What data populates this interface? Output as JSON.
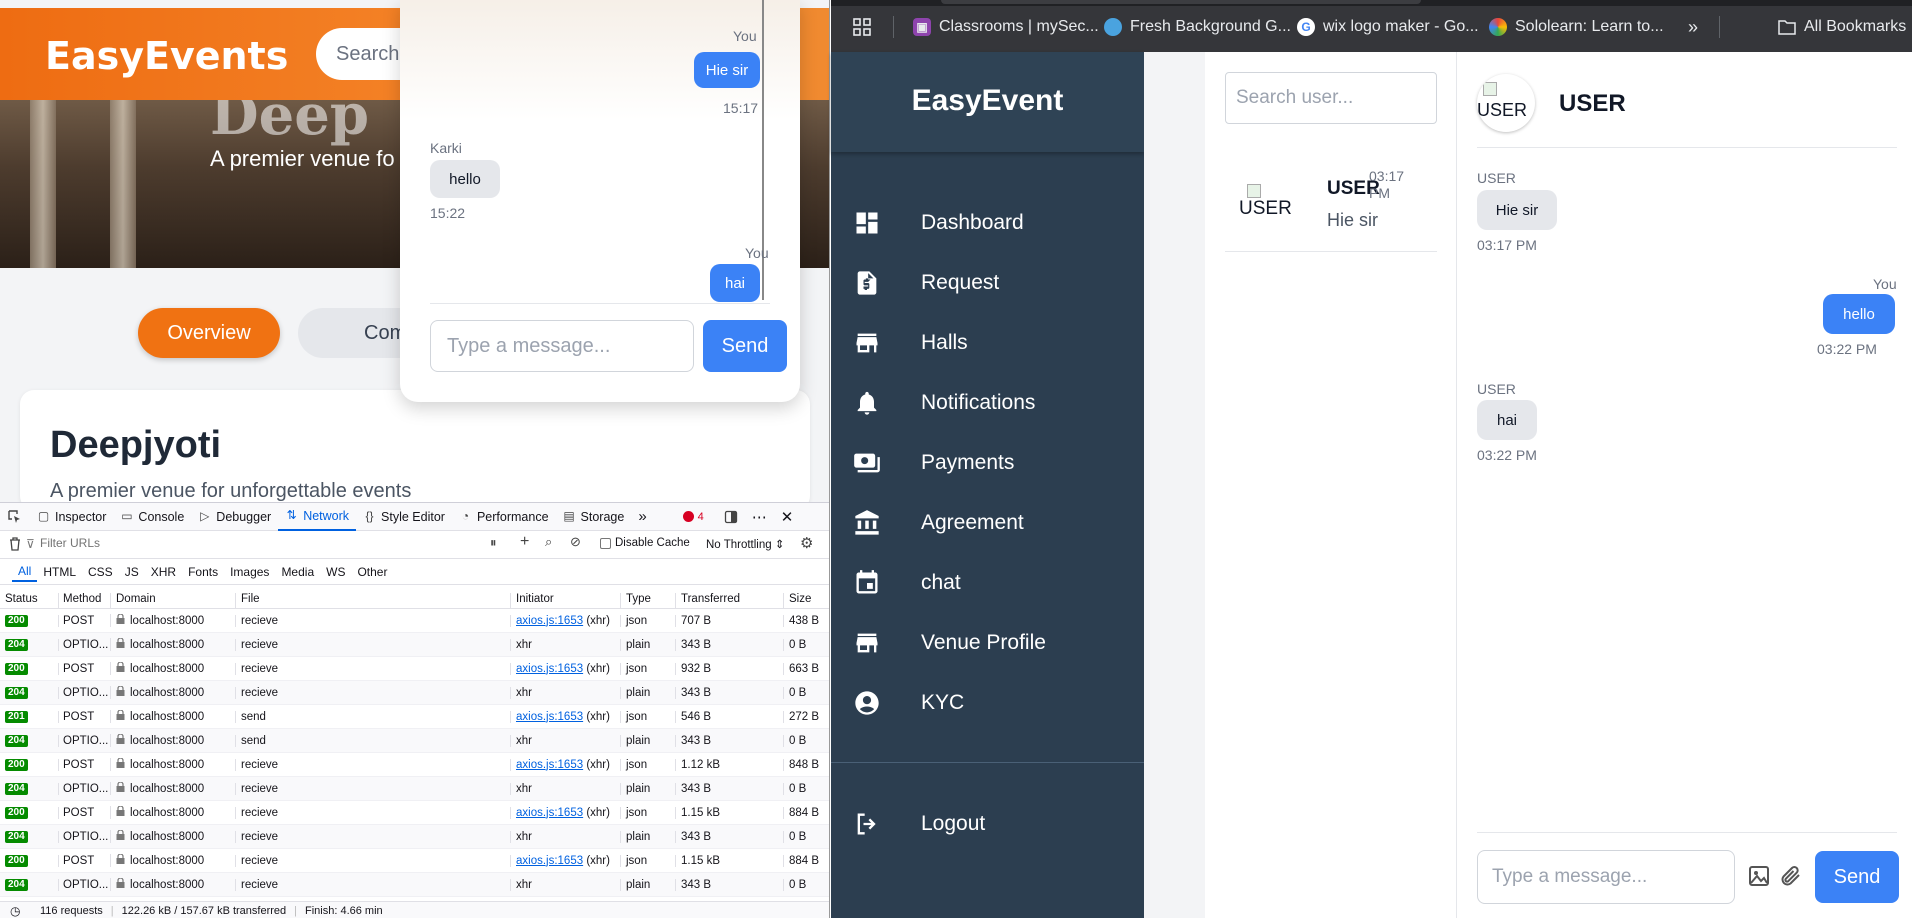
{
  "left_app": {
    "logo": "EasyEvents",
    "search_placeholder": "Search",
    "hero_title": "Deep",
    "hero_subtitle": "A premier venue fo",
    "tabs": {
      "overview": "Overview",
      "complete": "Comple"
    },
    "venue_name": "Deepjyoti",
    "venue_tagline": "A premier venue for unforgettable events"
  },
  "popup_chat": {
    "messages": [
      {
        "sender": "You",
        "text": "Hie sir",
        "time": "15:17"
      },
      {
        "sender": "Karki",
        "text": "hello",
        "time": "15:22"
      },
      {
        "sender": "You",
        "text": "hai"
      }
    ],
    "input_placeholder": "Type a message...",
    "send_label": "Send"
  },
  "devtools": {
    "tabs": [
      "Inspector",
      "Console",
      "Debugger",
      "Network",
      "Style Editor",
      "Performance",
      "Storage"
    ],
    "active_tab": "Network",
    "error_count": "4",
    "filter_placeholder": "Filter URLs",
    "disable_cache": "Disable Cache",
    "throttling": "No Throttling",
    "type_filters": [
      "All",
      "HTML",
      "CSS",
      "JS",
      "XHR",
      "Fonts",
      "Images",
      "Media",
      "WS",
      "Other"
    ],
    "columns": [
      "Status",
      "Method",
      "Domain",
      "File",
      "Initiator",
      "Type",
      "Transferred",
      "Size"
    ],
    "rows": [
      {
        "status": "200",
        "method": "POST",
        "domain": "localhost:8000",
        "file": "recieve",
        "initiator_link": "axios.js:1653",
        "initiator_suffix": " (xhr)",
        "type": "json",
        "transferred": "707 B",
        "size": "438 B"
      },
      {
        "status": "204",
        "method": "OPTIO...",
        "domain": "localhost:8000",
        "file": "recieve",
        "initiator_link": "",
        "initiator_suffix": "xhr",
        "type": "plain",
        "transferred": "343 B",
        "size": "0 B"
      },
      {
        "status": "200",
        "method": "POST",
        "domain": "localhost:8000",
        "file": "recieve",
        "initiator_link": "axios.js:1653",
        "initiator_suffix": " (xhr)",
        "type": "json",
        "transferred": "932 B",
        "size": "663 B"
      },
      {
        "status": "204",
        "method": "OPTIO...",
        "domain": "localhost:8000",
        "file": "recieve",
        "initiator_link": "",
        "initiator_suffix": "xhr",
        "type": "plain",
        "transferred": "343 B",
        "size": "0 B"
      },
      {
        "status": "201",
        "method": "POST",
        "domain": "localhost:8000",
        "file": "send",
        "initiator_link": "axios.js:1653",
        "initiator_suffix": " (xhr)",
        "type": "json",
        "transferred": "546 B",
        "size": "272 B"
      },
      {
        "status": "204",
        "method": "OPTIO...",
        "domain": "localhost:8000",
        "file": "send",
        "initiator_link": "",
        "initiator_suffix": "xhr",
        "type": "plain",
        "transferred": "343 B",
        "size": "0 B"
      },
      {
        "status": "200",
        "method": "POST",
        "domain": "localhost:8000",
        "file": "recieve",
        "initiator_link": "axios.js:1653",
        "initiator_suffix": " (xhr)",
        "type": "json",
        "transferred": "1.12 kB",
        "size": "848 B"
      },
      {
        "status": "204",
        "method": "OPTIO...",
        "domain": "localhost:8000",
        "file": "recieve",
        "initiator_link": "",
        "initiator_suffix": "xhr",
        "type": "plain",
        "transferred": "343 B",
        "size": "0 B"
      },
      {
        "status": "200",
        "method": "POST",
        "domain": "localhost:8000",
        "file": "recieve",
        "initiator_link": "axios.js:1653",
        "initiator_suffix": " (xhr)",
        "type": "json",
        "transferred": "1.15 kB",
        "size": "884 B"
      },
      {
        "status": "204",
        "method": "OPTIO...",
        "domain": "localhost:8000",
        "file": "recieve",
        "initiator_link": "",
        "initiator_suffix": "xhr",
        "type": "plain",
        "transferred": "343 B",
        "size": "0 B"
      },
      {
        "status": "200",
        "method": "POST",
        "domain": "localhost:8000",
        "file": "recieve",
        "initiator_link": "axios.js:1653",
        "initiator_suffix": " (xhr)",
        "type": "json",
        "transferred": "1.15 kB",
        "size": "884 B"
      },
      {
        "status": "204",
        "method": "OPTIO...",
        "domain": "localhost:8000",
        "file": "recieve",
        "initiator_link": "",
        "initiator_suffix": "xhr",
        "type": "plain",
        "transferred": "343 B",
        "size": "0 B"
      }
    ],
    "footer": {
      "requests": "116 requests",
      "transferred": "122.26 kB / 157.67 kB transferred",
      "finish": "Finish: 4.66 min"
    }
  },
  "bookmarks": {
    "items": [
      {
        "label": "Classrooms | mySec...",
        "icon": "classroom-icon",
        "color": "#8e44ad"
      },
      {
        "label": "Fresh Background G...",
        "icon": "fresh-bg-icon",
        "color": "#4aa3df"
      },
      {
        "label": "wix logo maker - Go...",
        "icon": "google-icon",
        "color": "#ffffff"
      },
      {
        "label": "Sololearn: Learn to...",
        "icon": "sololearn-icon",
        "color": "#e8453c"
      }
    ],
    "all_bookmarks": "All Bookmarks"
  },
  "sidebar": {
    "logo": "EasyEvent",
    "items": [
      {
        "label": "Dashboard",
        "icon": "dashboard-icon"
      },
      {
        "label": "Request",
        "icon": "request-icon"
      },
      {
        "label": "Halls",
        "icon": "halls-icon"
      },
      {
        "label": "Notifications",
        "icon": "bell-icon"
      },
      {
        "label": "Payments",
        "icon": "payments-icon"
      },
      {
        "label": "Agreement",
        "icon": "bank-icon"
      },
      {
        "label": "chat",
        "icon": "calendar-icon"
      },
      {
        "label": "Venue Profile",
        "icon": "store-icon"
      },
      {
        "label": "KYC",
        "icon": "user-circle-icon"
      }
    ],
    "logout": "Logout"
  },
  "users_panel": {
    "search_placeholder": "Search user...",
    "user": {
      "avatar_alt": "USER",
      "name": "USER",
      "time": "03:17 PM",
      "last_message": "Hie sir"
    }
  },
  "chat_panel": {
    "avatar_alt": "USER",
    "title": "USER",
    "messages": [
      {
        "sender": "USER",
        "text": "Hie sir",
        "time": "03:17 PM"
      },
      {
        "sender": "You",
        "text": "hello",
        "time": "03:22 PM"
      },
      {
        "sender": "USER",
        "text": "hai",
        "time": "03:22 PM"
      }
    ],
    "input_placeholder": "Type a message...",
    "send_label": "Send"
  }
}
